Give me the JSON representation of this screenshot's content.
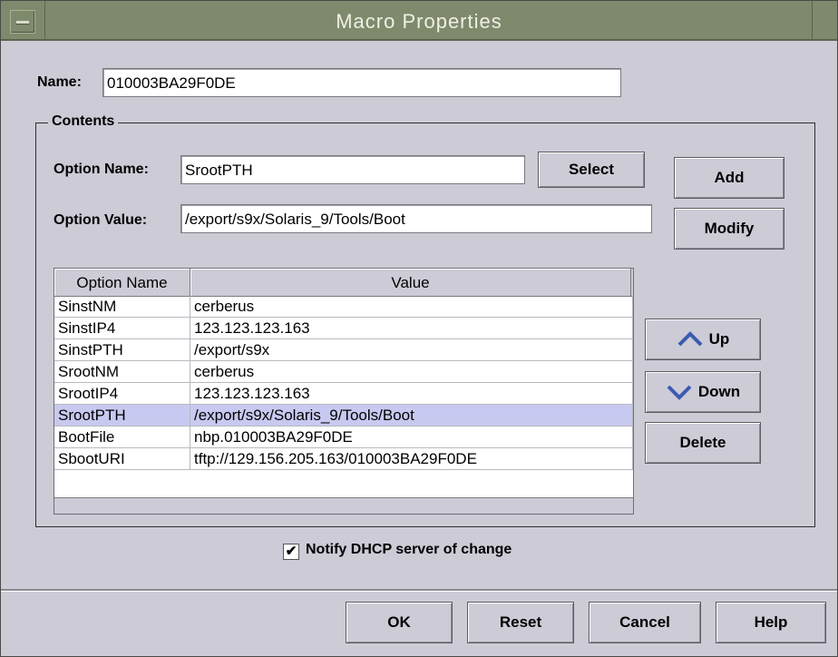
{
  "window": {
    "title": "Macro Properties"
  },
  "name_field": {
    "label": "Name:",
    "value": "010003BA29F0DE"
  },
  "contents": {
    "legend": "Contents",
    "option_name_label": "Option Name:",
    "option_name_value": "SrootPTH",
    "option_value_label": "Option Value:",
    "option_value_value": "/export/s9x/Solaris_9/Tools/Boot",
    "select_label": "Select",
    "add_label": "Add",
    "modify_label": "Modify",
    "up_label": "Up",
    "down_label": "Down",
    "delete_label": "Delete"
  },
  "table": {
    "columns": [
      "Option Name",
      "Value"
    ],
    "rows": [
      {
        "name": "SinstNM",
        "value": "cerberus"
      },
      {
        "name": "SinstIP4",
        "value": "123.123.123.163"
      },
      {
        "name": "SinstPTH",
        "value": "/export/s9x"
      },
      {
        "name": "SrootNM",
        "value": "cerberus"
      },
      {
        "name": "SrootIP4",
        "value": "123.123.123.163"
      },
      {
        "name": "SrootPTH",
        "value": "/export/s9x/Solaris_9/Tools/Boot"
      },
      {
        "name": "BootFile",
        "value": "nbp.010003BA29F0DE"
      },
      {
        "name": "SbootURI",
        "value": "tftp://129.156.205.163/010003BA29F0DE"
      }
    ],
    "selected_index": 5
  },
  "notify": {
    "label": "Notify DHCP server of change",
    "checked_mark": "✔"
  },
  "footer": {
    "ok": "OK",
    "reset": "Reset",
    "cancel": "Cancel",
    "help": "Help"
  },
  "colors": {
    "titlebar": "#7f8a6c",
    "selection": "#c8c9f0",
    "background": "#cccbd6"
  }
}
